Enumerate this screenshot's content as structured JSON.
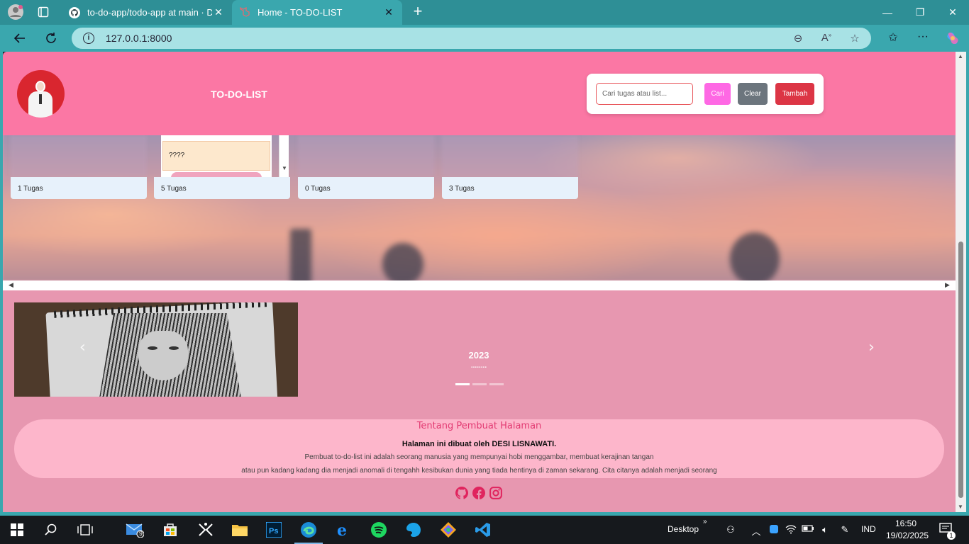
{
  "browser": {
    "tabs": [
      {
        "title": "to-do-app/todo-app at main · DE",
        "active": false
      },
      {
        "title": "Home - TO-DO-LIST",
        "active": true
      }
    ],
    "url": "127.0.0.1:8000"
  },
  "header": {
    "title": "TO-DO-LIST",
    "search_placeholder": "Cari tugas atau list...",
    "btn_search": "Cari",
    "btn_clear": "Clear",
    "btn_add": "Tambah"
  },
  "cards": [
    {
      "count_label": "1 Tugas"
    },
    {
      "count_label": "5 Tugas",
      "note": "????"
    },
    {
      "count_label": "0 Tugas"
    },
    {
      "count_label": "3 Tugas"
    }
  ],
  "carousel": {
    "caption_title": "2023",
    "caption_text": "........",
    "slide_count": 3,
    "active_slide": 1
  },
  "about": {
    "heading": "Tentang Pembuat Halaman",
    "author_line": "Halaman ini dibuat oleh DESI LISNAWATI.",
    "line1": "Pembuat to-do-list ini adalah seorang manusia yang mempunyai hobi menggambar, membuat kerajinan tangan",
    "line2": "atau pun kadang kadang dia menjadi anomali di tengahh kesibukan dunia yang tiada hentinya di zaman sekarang. Cita citanya adalah menjadi seorang"
  },
  "socials": [
    "github-icon",
    "facebook-icon",
    "instagram-icon"
  ],
  "taskbar": {
    "mail_badge": "9",
    "desktop_label": "Desktop",
    "lang": "IND",
    "time": "16:50",
    "date": "19/02/2025",
    "notif_count": "1"
  },
  "colors": {
    "header": "#fb77a4",
    "page_bg": "#e797b0",
    "about_bg": "#fdb6cb",
    "btn_search": "#fe68e4",
    "btn_clear": "#6c757d",
    "btn_add": "#dc3545",
    "chrome": "#3aa7ae"
  }
}
